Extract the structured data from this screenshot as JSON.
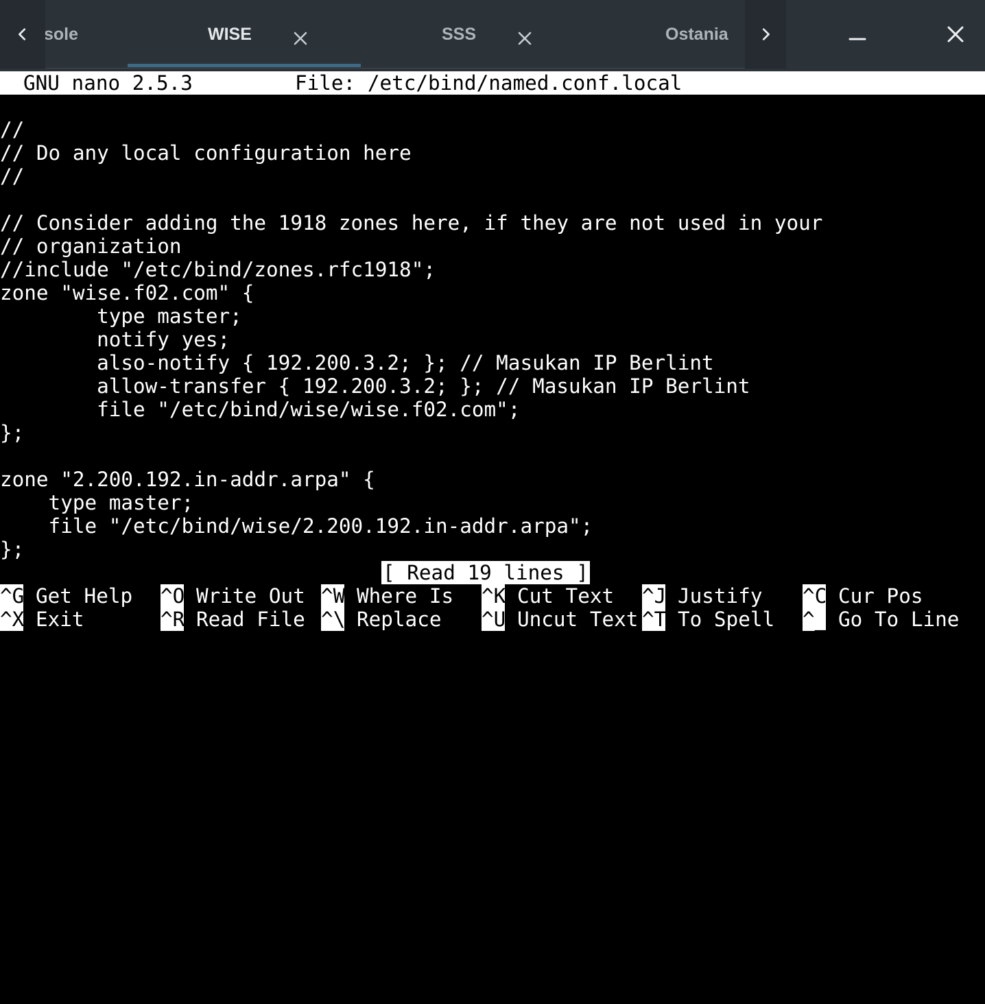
{
  "tabbar": {
    "tabs": [
      {
        "label": "sole",
        "close": false
      },
      {
        "label": "WISE",
        "close": true,
        "active": true
      },
      {
        "label": "SSS",
        "close": true
      },
      {
        "label": "Ostania",
        "close": false
      }
    ],
    "icons": {
      "prev": "chevron-left-icon",
      "next": "chevron-right-icon",
      "close_tab": "close-icon",
      "minimize": "minimize-icon",
      "close_window": "close-icon"
    },
    "colors": {
      "background": "#2b3238",
      "active_indicator": "#3e6a86"
    }
  },
  "nano": {
    "version": "GNU nano 2.5.3",
    "file": "File: /etc/bind/named.conf.local",
    "lines": [
      "//",
      "// Do any local configuration here",
      "//",
      "",
      "// Consider adding the 1918 zones here, if they are not used in your",
      "// organization",
      "//include \"/etc/bind/zones.rfc1918\";",
      "zone \"wise.f02.com\" {",
      "        type master;",
      "        notify yes;",
      "        also-notify { 192.200.3.2; }; // Masukan IP Berlint",
      "        allow-transfer { 192.200.3.2; }; // Masukan IP Berlint",
      "        file \"/etc/bind/wise/wise.f02.com\";",
      "};",
      "",
      "zone \"2.200.192.in-addr.arpa\" {",
      "    type master;",
      "    file \"/etc/bind/wise/2.200.192.in-addr.arpa\";",
      "};"
    ],
    "status": "[ Read 19 lines ]",
    "shortcuts_row1": [
      {
        "key": "^G",
        "label": "Get Help"
      },
      {
        "key": "^O",
        "label": "Write Out"
      },
      {
        "key": "^W",
        "label": "Where Is"
      },
      {
        "key": "^K",
        "label": "Cut Text"
      },
      {
        "key": "^J",
        "label": "Justify"
      },
      {
        "key": "^C",
        "label": "Cur Pos"
      }
    ],
    "shortcuts_row2": [
      {
        "key": "^X",
        "label": "Exit"
      },
      {
        "key": "^R",
        "label": "Read File"
      },
      {
        "key": "^\\",
        "label": "Replace"
      },
      {
        "key": "^U",
        "label": "Uncut Text"
      },
      {
        "key": "^T",
        "label": "To Spell"
      },
      {
        "key": "^_",
        "label": "Go To Line"
      }
    ]
  }
}
